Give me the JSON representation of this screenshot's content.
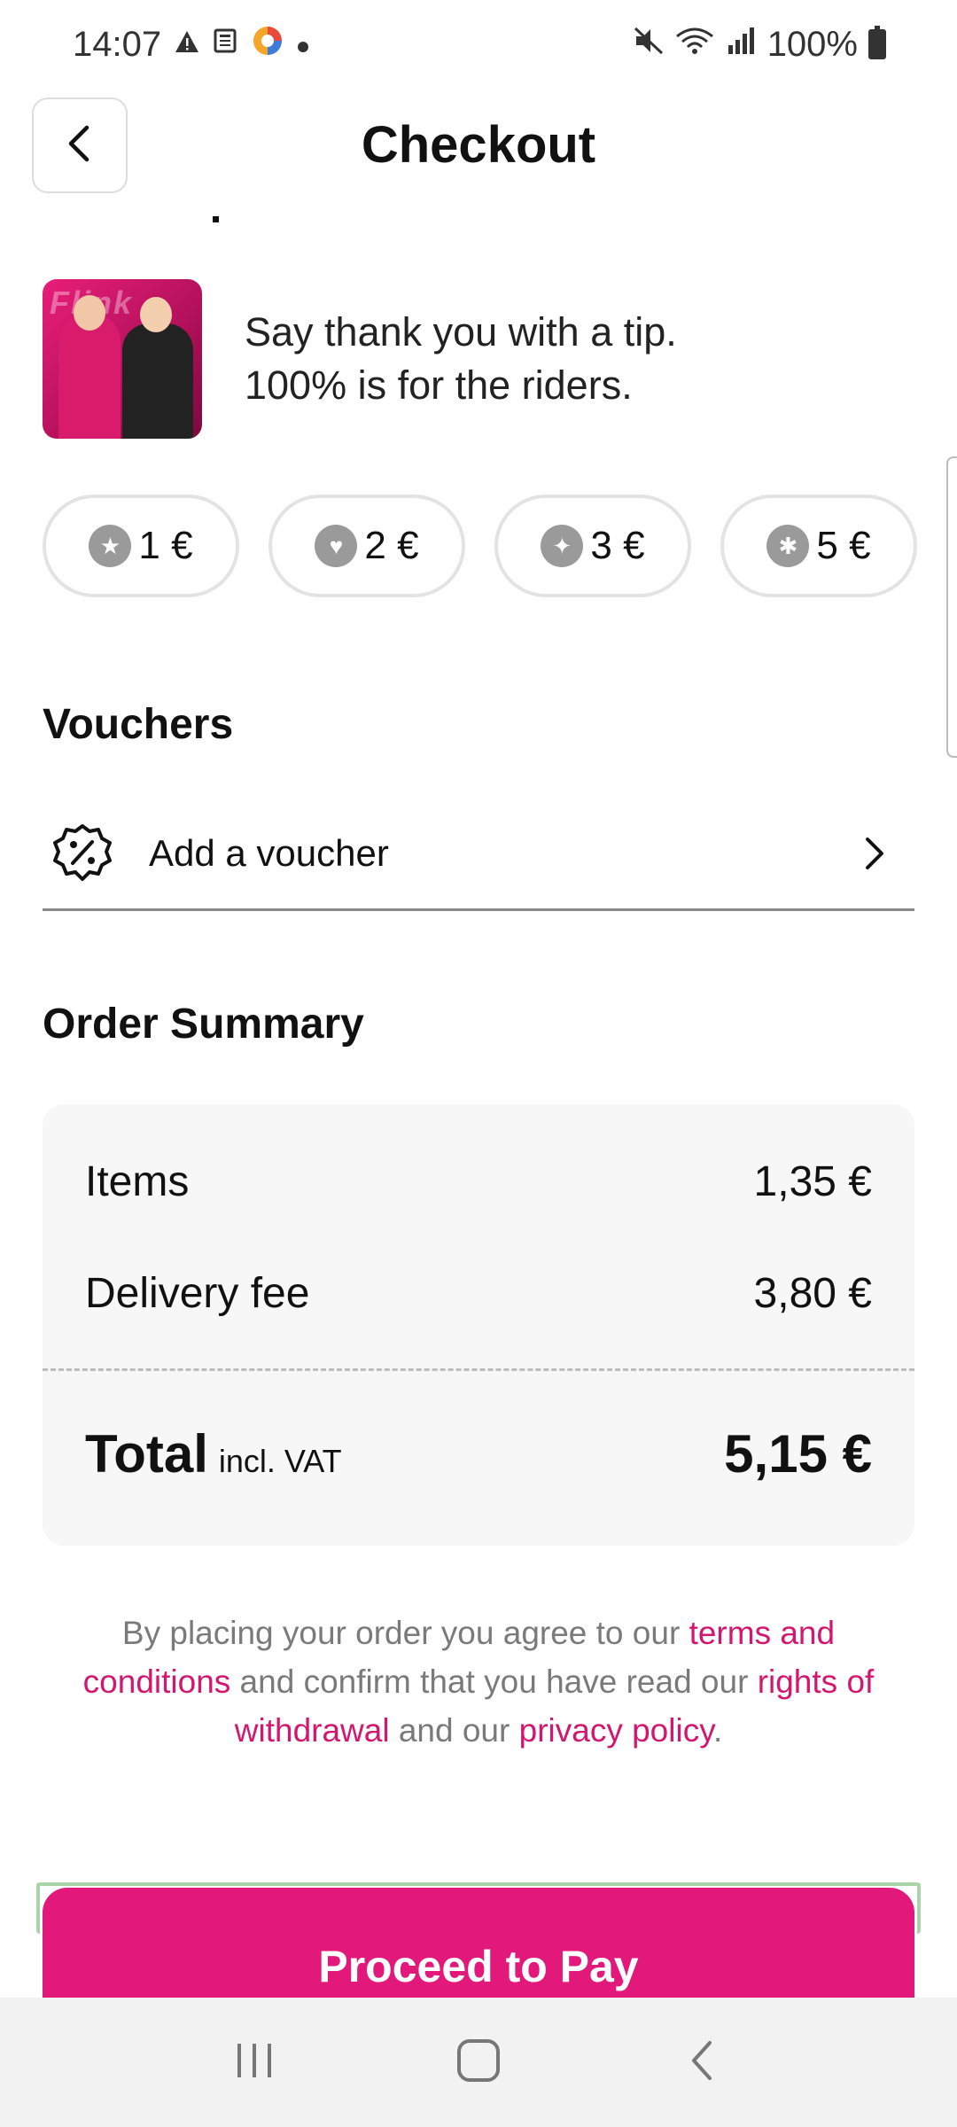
{
  "status_bar": {
    "time": "14:07",
    "battery": "100%",
    "icons": [
      "warning-icon",
      "news-icon",
      "app-icon",
      "dot-icon",
      "mute-icon",
      "wifi-icon",
      "signal-icon",
      "battery-icon"
    ]
  },
  "header": {
    "title": "Checkout",
    "back_icon": "chevron-left-icon"
  },
  "tip": {
    "image_brand": "Flink",
    "line1": "Say thank you with a tip.",
    "line2": "100% is for the riders.",
    "options": [
      {
        "emoji": "star-struck-icon",
        "label": "1 €"
      },
      {
        "emoji": "heart-eyes-icon",
        "label": "2 €"
      },
      {
        "emoji": "party-face-icon",
        "label": "3 €"
      },
      {
        "emoji": "party-popper-icon",
        "label": "5 €"
      }
    ]
  },
  "vouchers": {
    "title": "Vouchers",
    "add_label": "Add a voucher",
    "icon": "voucher-percent-icon"
  },
  "order_summary": {
    "title": "Order Summary",
    "items_label": "Items",
    "items_value": "1,35 €",
    "delivery_label": "Delivery fee",
    "delivery_value": "3,80 €",
    "total_label": "Total",
    "total_sub": "incl. VAT",
    "total_value": "5,15 €"
  },
  "legal": {
    "part1": "By placing your order you agree to our ",
    "terms_link": "terms and conditions",
    "part2": " and confirm that you have read our ",
    "withdrawal_link": "rights of withdrawal",
    "part3": " and our ",
    "privacy_link": "privacy policy",
    "part4": "."
  },
  "cta": {
    "label": "Proceed to Pay",
    "color": "#e2187a"
  },
  "colors": {
    "accent": "#e2187a",
    "link": "#d3176e"
  }
}
